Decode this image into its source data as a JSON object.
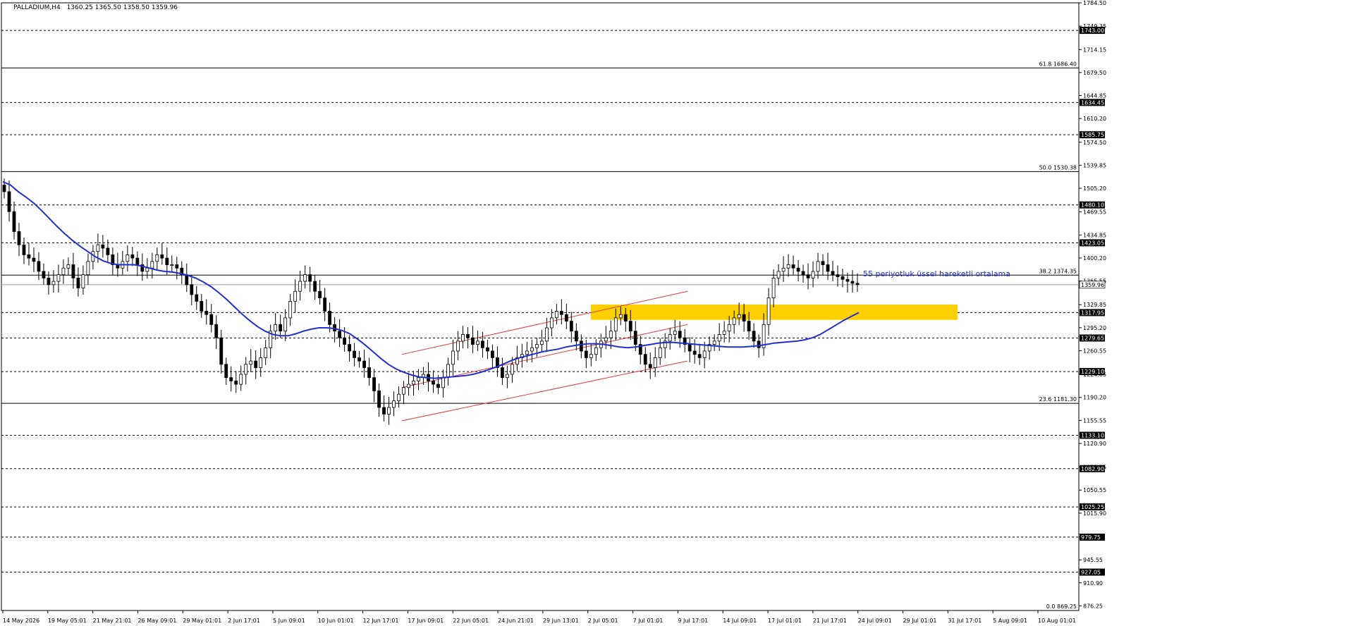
{
  "window": {
    "title_symbol": "PALLADIUM,H4",
    "ohlc": "1360.25 1365.50 1358.50 1359.96"
  },
  "colors": {
    "background": "#ffffff",
    "candle": "#000000",
    "ema": "#1f2fd1",
    "channel": "#e33a3a",
    "zone": "#ffd000",
    "grid": "#000000",
    "label_bg": "#000000",
    "label_text": "#ffffff",
    "annotation_text": "#1f2fd1"
  },
  "chart_data": {
    "type": "line",
    "instrument": "PALLADIUM",
    "timeframe": "H4",
    "ylim": [
      869.25,
      1784.5
    ],
    "y_tick_labels": [
      "1784.50",
      "1749.35",
      "1714.15",
      "1679.50",
      "1644.85",
      "1610.20",
      "1574.50",
      "1539.85",
      "1505.20",
      "1469.55",
      "1434.85",
      "1400.20",
      "1365.55",
      "1329.85",
      "1295.20",
      "1260.55",
      "1224.85",
      "1190.20",
      "1155.55",
      "1120.90",
      "1085.25",
      "1050.55",
      "1015.90",
      "980.25",
      "945.55",
      "910.90",
      "876.25"
    ],
    "x_tick_labels": [
      "14 May 2026",
      "19 May 05:01",
      "21 May 21:01",
      "26 May 09:01",
      "29 May 01:01",
      "2 Jun 17:01",
      "5 Jun 09:01",
      "10 Jun 01:01",
      "12 Jun 17:01",
      "17 Jun 09:01",
      "22 Jun 05:01",
      "24 Jun 21:01",
      "29 Jun 13:01",
      "2 Jul 05:01",
      "7 Jul 01:01",
      "9 Jul 17:01",
      "14 Jul 09:01",
      "17 Jul 01:01",
      "21 Jul 17:01",
      "24 Jul 09:01",
      "29 Jul 01:01",
      "31 Jul 17:01",
      "5 Aug 09:01",
      "10 Aug 01:01"
    ],
    "dashed_levels": [
      {
        "value": 1743.0,
        "label": "1743.00"
      },
      {
        "value": 1634.45,
        "label": "1634.45"
      },
      {
        "value": 1585.75,
        "label": "1585.75"
      },
      {
        "value": 1480.1,
        "label": "1480.10"
      },
      {
        "value": 1423.05,
        "label": "1423.05"
      },
      {
        "value": 1317.95,
        "label": "1317.95"
      },
      {
        "value": 1279.65,
        "label": "1279.65"
      },
      {
        "value": 1229.1,
        "label": "1229.10"
      },
      {
        "value": 1133.1,
        "label": "1133.10"
      },
      {
        "value": 1082.9,
        "label": "1082.90"
      },
      {
        "value": 1025.25,
        "label": "1025.25"
      },
      {
        "value": 979.75,
        "label": "979.75"
      },
      {
        "value": 927.05,
        "label": "927.05"
      }
    ],
    "fibonacci_levels": [
      {
        "value": 1686.4,
        "label": "61.8 1686.40"
      },
      {
        "value": 1530.38,
        "label": "50.0 1530.38"
      },
      {
        "value": 1374.35,
        "label": "38.2 1374.35"
      },
      {
        "value": 1181.3,
        "label": "23.6 1181.30"
      },
      {
        "value": 869.25,
        "label": "0.0 869.25"
      }
    ],
    "current_price": {
      "value": 1359.96,
      "label": "1359.96"
    },
    "resistance_zone": {
      "from": 1307,
      "to": 1330
    },
    "ema_label": "55 periyotluk üssel hareketli ortalama",
    "price_series": [
      1500,
      1470,
      1440,
      1420,
      1405,
      1400,
      1395,
      1380,
      1370,
      1360,
      1365,
      1375,
      1385,
      1390,
      1370,
      1355,
      1375,
      1395,
      1410,
      1420,
      1415,
      1405,
      1390,
      1385,
      1395,
      1405,
      1400,
      1390,
      1380,
      1385,
      1395,
      1405,
      1400,
      1390,
      1390,
      1385,
      1375,
      1360,
      1345,
      1335,
      1320,
      1315,
      1300,
      1280,
      1240,
      1220,
      1215,
      1210,
      1225,
      1240,
      1245,
      1235,
      1250,
      1265,
      1290,
      1300,
      1290,
      1310,
      1335,
      1350,
      1365,
      1375,
      1365,
      1350,
      1340,
      1320,
      1300,
      1290,
      1280,
      1270,
      1260,
      1250,
      1245,
      1235,
      1220,
      1200,
      1175,
      1165,
      1175,
      1185,
      1195,
      1205,
      1210,
      1215,
      1220,
      1225,
      1215,
      1210,
      1205,
      1220,
      1240,
      1260,
      1275,
      1285,
      1280,
      1270,
      1275,
      1265,
      1260,
      1250,
      1235,
      1220,
      1225,
      1240,
      1250,
      1255,
      1260,
      1265,
      1270,
      1275,
      1295,
      1310,
      1320,
      1315,
      1305,
      1290,
      1275,
      1260,
      1250,
      1255,
      1265,
      1275,
      1280,
      1290,
      1310,
      1315,
      1305,
      1290,
      1270,
      1255,
      1240,
      1235,
      1250,
      1265,
      1275,
      1285,
      1290,
      1280,
      1270,
      1260,
      1255,
      1250,
      1260,
      1270,
      1275,
      1285,
      1290,
      1300,
      1310,
      1315,
      1305,
      1290,
      1275,
      1265,
      1300,
      1340,
      1370,
      1380,
      1385,
      1390,
      1385,
      1380,
      1375,
      1370,
      1380,
      1395,
      1390,
      1380,
      1375,
      1372,
      1368,
      1365,
      1362,
      1360
    ],
    "ema_series": [
      1515,
      1510,
      1500,
      1492,
      1483,
      1472,
      1460,
      1448,
      1437,
      1427,
      1418,
      1410,
      1402,
      1396,
      1392,
      1390,
      1390,
      1390,
      1388,
      1385,
      1382,
      1380,
      1379,
      1377,
      1374,
      1370,
      1364,
      1357,
      1348,
      1338,
      1327,
      1316,
      1306,
      1297,
      1290,
      1285,
      1283,
      1283,
      1286,
      1290,
      1293,
      1295,
      1295,
      1294,
      1291,
      1286,
      1278,
      1269,
      1259,
      1249,
      1240,
      1233,
      1228,
      1224,
      1221,
      1220,
      1219,
      1220,
      1221,
      1222,
      1223,
      1225,
      1228,
      1232,
      1236,
      1241,
      1246,
      1250,
      1253,
      1256,
      1259,
      1261,
      1263,
      1266,
      1268,
      1270,
      1271,
      1271,
      1270,
      1268,
      1266,
      1265,
      1266,
      1268,
      1270,
      1272,
      1273,
      1273,
      1272,
      1271,
      1270,
      1269,
      1268,
      1267,
      1266,
      1266,
      1266,
      1267,
      1268,
      1270,
      1272,
      1273,
      1274,
      1275,
      1277,
      1280,
      1285,
      1292,
      1299,
      1306,
      1312,
      1318
    ],
    "channel": {
      "lower": [
        {
          "date": "23 Jun",
          "price": 1155
        },
        {
          "date": "21 Jul",
          "price": 1245
        }
      ],
      "mid": [
        {
          "date": "23 Jun",
          "price": 1205
        },
        {
          "date": "21 Jul",
          "price": 1300
        }
      ],
      "upper": [
        {
          "date": "23 Jun",
          "price": 1255
        },
        {
          "date": "21 Jul",
          "price": 1350
        }
      ]
    }
  }
}
